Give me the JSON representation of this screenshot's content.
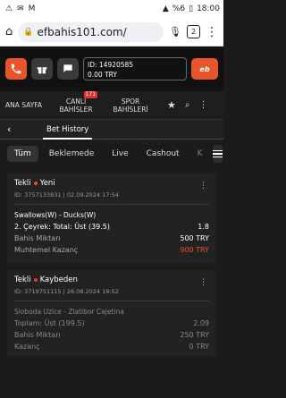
{
  "status": {
    "time": "18:00",
    "battery": "%6"
  },
  "browser": {
    "url": "efbahis101.com/",
    "tab_count": "2"
  },
  "account": {
    "id": "ID: 14920585",
    "balance": "0.00 TRY"
  },
  "nav": {
    "items": [
      {
        "label": "ANA SAYFA"
      },
      {
        "label": "CANLI BAHİSLER",
        "badge": "171"
      },
      {
        "label": "SPOR BAHİSLERİ"
      }
    ]
  },
  "page": {
    "title": "Bet History"
  },
  "filters": [
    "Tüm",
    "Beklemede",
    "Live",
    "Cashout",
    "K"
  ],
  "bets": [
    {
      "type": "Tekli",
      "status": "Yeni",
      "status_color": "#e8552a",
      "meta": "ID: 3757133831 | 02.09.2024 17:54",
      "match": "Swallows(W) - Ducks(W)",
      "selection": "2. Çeyrek: Total:  Üst (39.5)",
      "odds": "1.8",
      "stake_label": "Bahis Miktarı",
      "stake": "500 TRY",
      "win_label": "Muhtemel Kazanç",
      "win": "900 TRY"
    },
    {
      "type": "Tekli",
      "status": "Kaybeden",
      "status_color": "#e03a3a",
      "meta": "ID: 3719751115 | 26.08.2024 19:52",
      "match": "Sloboda Uzice - Zlatibor Cajetina",
      "selection": "Toplam:  Üst (199.5)",
      "odds": "2.09",
      "stake_label": "Bahis Miktarı",
      "stake": "250 TRY",
      "win_label": "Kazanç",
      "win": "0 TRY"
    }
  ]
}
